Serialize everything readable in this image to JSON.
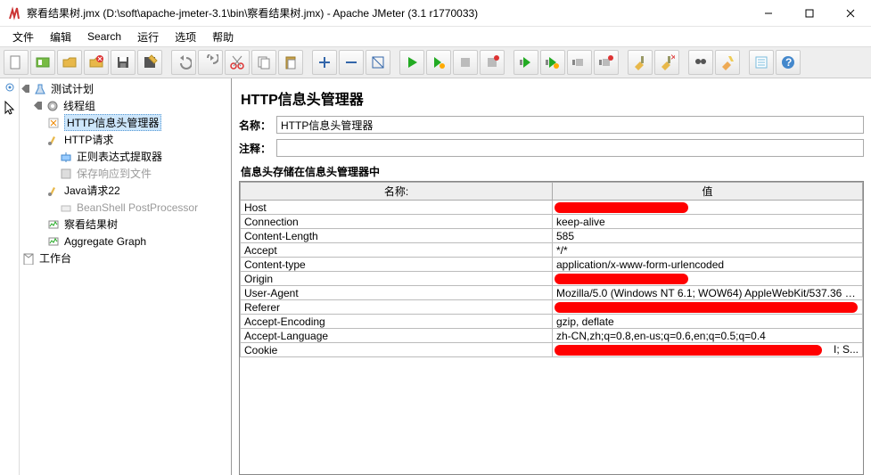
{
  "window": {
    "title": "察看结果树.jmx (D:\\soft\\apache-jmeter-3.1\\bin\\察看结果树.jmx) - Apache JMeter (3.1 r1770033)"
  },
  "menu": {
    "file": "文件",
    "edit": "编辑",
    "search": "Search",
    "run": "运行",
    "options": "选项",
    "help": "帮助"
  },
  "tree": {
    "root": "测试计划",
    "threadGroup": "线程组",
    "items": [
      "HTTP信息头管理器",
      "HTTP请求",
      "正则表达式提取器",
      "保存响应到文件",
      "Java请求22",
      "BeanShell PostProcessor",
      "察看结果树",
      "Aggregate Graph"
    ],
    "workbench": "工作台"
  },
  "form": {
    "header": "HTTP信息头管理器",
    "nameLabel": "名称：",
    "nameValue": "HTTP信息头管理器",
    "commentLabel": "注释：",
    "commentValue": "",
    "section": "信息头存储在信息头管理器中",
    "colName": "名称:",
    "colValue": "值"
  },
  "headers": [
    {
      "name": "Host",
      "value": "",
      "redact": "r1"
    },
    {
      "name": "Connection",
      "value": "keep-alive"
    },
    {
      "name": "Content-Length",
      "value": "585"
    },
    {
      "name": "Accept",
      "value": "*/*"
    },
    {
      "name": "Content-type",
      "value": "application/x-www-form-urlencoded"
    },
    {
      "name": "Origin",
      "value": "",
      "redact": "r1"
    },
    {
      "name": "User-Agent",
      "value": "Mozilla/5.0 (Windows NT 6.1; WOW64) AppleWebKit/537.36 (K..."
    },
    {
      "name": "Referer",
      "value": "",
      "redact": "r2"
    },
    {
      "name": "Accept-Encoding",
      "value": "gzip, deflate"
    },
    {
      "name": "Accept-Language",
      "value": "zh-CN,zh;q=0.8,en-us;q=0.6,en;q=0.5;q=0.4"
    },
    {
      "name": "Cookie",
      "value": "",
      "redact": "r3",
      "suffix": "I; S..."
    }
  ]
}
